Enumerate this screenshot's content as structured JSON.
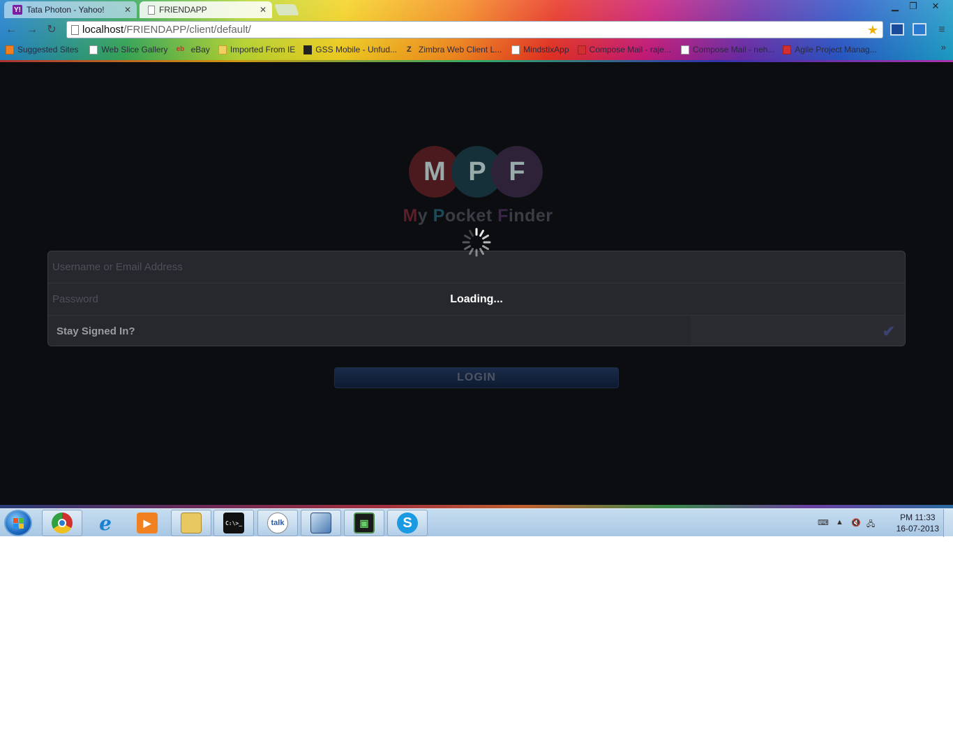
{
  "browser": {
    "tabs": [
      {
        "title": "Tata Photon - Yahoo!",
        "icon": "yahoo-icon",
        "active": false
      },
      {
        "title": "FRIENDAPP",
        "icon": "page-icon",
        "active": true
      }
    ],
    "url_host": "localhost",
    "url_path": "/FRIENDAPP/client/default/",
    "bookmarks": [
      {
        "label": "Suggested Sites",
        "icon": "suggested-sites-icon"
      },
      {
        "label": "Web Slice Gallery",
        "icon": "page-icon"
      },
      {
        "label": "eBay",
        "icon": "ebay-icon"
      },
      {
        "label": "Imported From IE",
        "icon": "folder-icon"
      },
      {
        "label": "GSS Mobile - Unfud...",
        "icon": "gss-icon"
      },
      {
        "label": "Zimbra Web Client L...",
        "icon": "zimbra-icon"
      },
      {
        "label": "MindstixApp",
        "icon": "page-icon"
      },
      {
        "label": "Compose Mail - raje...",
        "icon": "gmail-icon"
      },
      {
        "label": "Compose Mail - neh...",
        "icon": "page-icon"
      },
      {
        "label": "Agile Project Manag...",
        "icon": "agile-icon"
      }
    ],
    "bookmarks_more": "»"
  },
  "app": {
    "logo_letters": [
      "M",
      "P",
      "F"
    ],
    "logo_colors": [
      "#4a1a1e",
      "#16303a",
      "#2e2238"
    ],
    "tagline_words": [
      {
        "first": "M",
        "rest": "y"
      },
      {
        "first": "P",
        "rest": "ocket"
      },
      {
        "first": "F",
        "rest": "inder"
      }
    ],
    "username_placeholder": "Username or Email Address",
    "password_placeholder": "Password",
    "stay_signed_in_label": "Stay Signed In?",
    "stay_signed_in_checked": true,
    "login_label": "LOGIN",
    "loading_text": "Loading..."
  },
  "taskbar": {
    "apps": [
      {
        "name": "chrome",
        "icon": "chrome-icon"
      },
      {
        "name": "internet-explorer",
        "icon": "ie-icon"
      },
      {
        "name": "media-player",
        "icon": "media-player-icon"
      },
      {
        "name": "explorer",
        "icon": "folder-icon"
      },
      {
        "name": "command-prompt",
        "icon": "cmd-icon"
      },
      {
        "name": "google-talk",
        "icon": "talk-icon"
      },
      {
        "name": "virtualbox",
        "icon": "virtualbox-icon"
      },
      {
        "name": "eclipse-terminal",
        "icon": "terminal-icon"
      },
      {
        "name": "skype",
        "icon": "skype-icon"
      }
    ],
    "talk_label": "talk",
    "cmd_label": "C:\\>_",
    "clock_time": "PM 11:33",
    "clock_date": "16-07-2013"
  }
}
